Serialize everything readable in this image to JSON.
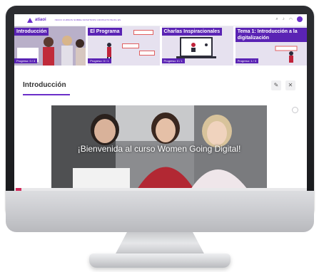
{
  "topbar": {
    "brand": "atiaoi",
    "nav": "INICIO  CURSOS  SOBRE  NOSOTROS  CONTACTO  BLOG  ES"
  },
  "cards": [
    {
      "title": "Introducción",
      "progress": "Progreso: 0 / 3"
    },
    {
      "title": "El Programa",
      "progress": "Progreso: 0 / 1"
    },
    {
      "title": "Charlas Inspiracionales",
      "progress": "Progreso: 0 / 1"
    },
    {
      "title": "Tema 1: Introducción a la digitalización",
      "progress": "Progreso: 1 / 3"
    }
  ],
  "section": {
    "title": "Introducción",
    "edit_icon": "pencil-icon",
    "close_icon": "close-icon"
  },
  "hero": {
    "caption": "¡Bienvenida al curso Women Going Digital!"
  },
  "colors": {
    "accent": "#6b2fc9",
    "card_label": "#5a23b4",
    "scroll_accent": "#d12a5a"
  }
}
